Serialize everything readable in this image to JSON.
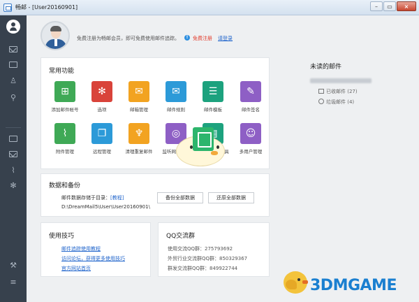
{
  "window": {
    "title": "畅邮 - [User20160901]",
    "min_label": "–",
    "max_label": "▭",
    "close_label": "×"
  },
  "sidebar": {
    "icons": [
      "avatar-icon",
      "mail-icon",
      "calendar-icon",
      "contacts-icon",
      "search-icon",
      "contact-card-icon",
      "compose-icon",
      "attachment-icon",
      "settings-icon",
      "tools-icon",
      "menu-icon"
    ]
  },
  "profile": {
    "free_text": "免费注册为畅邮会员，即可免费使用邮件追踪。",
    "register_label": "免费注册",
    "login_label": "请登录"
  },
  "common": {
    "title": "常用功能",
    "features": [
      {
        "label": "添加邮件帐号",
        "color": "#3fa956",
        "icon": "add-account-icon",
        "glyph": "⊞"
      },
      {
        "label": "选项",
        "color": "#d9433a",
        "icon": "gear-icon",
        "glyph": "✻"
      },
      {
        "label": "邮箱管理",
        "color": "#f2a321",
        "icon": "mailbox-manage-icon",
        "glyph": "✉"
      },
      {
        "label": "邮件规则",
        "color": "#2c9ad8",
        "icon": "mail-rule-icon",
        "glyph": "✉"
      },
      {
        "label": "邮件模板",
        "color": "#1da27e",
        "icon": "template-icon",
        "glyph": "☰"
      },
      {
        "label": "邮件签名",
        "color": "#8e5fc5",
        "icon": "signature-icon",
        "glyph": "✎"
      },
      {
        "label": "附件管理",
        "color": "#3fa956",
        "icon": "paperclip-icon",
        "glyph": "⌇"
      },
      {
        "label": "远程管理",
        "color": "#2c9ad8",
        "icon": "remote-icon",
        "glyph": "❐"
      },
      {
        "label": "清理重复邮件",
        "color": "#f2a321",
        "icon": "broom-icon",
        "glyph": "♆"
      },
      {
        "label": "监听网络数据",
        "color": "#8e5fc5",
        "icon": "radar-icon",
        "glyph": "◎"
      },
      {
        "label": "数据库修复工具",
        "color": "#1da27e",
        "icon": "database-repair-icon",
        "glyph": "▤"
      },
      {
        "label": "多用户管理",
        "color": "#8e5fc5",
        "icon": "users-icon",
        "glyph": "☺"
      }
    ]
  },
  "backup": {
    "title": "数据和备份",
    "path_label": "邮件数据存储于目录：",
    "tutorial_label": "[教程]",
    "path": "D:\\DreamMail5\\User\\User20160901\\",
    "backup_button": "备份全部数据",
    "restore_button": "还原全部数据"
  },
  "tips": {
    "title": "使用技巧",
    "links": [
      "邮件追踪使用教程",
      "访问论坛，获得更多使用技巧",
      "官方网站首页"
    ]
  },
  "qq": {
    "title": "QQ交流群",
    "lines": [
      "使用交流QQ群：275793692",
      "外贸行业交流群QQ群：850329367",
      "群发交流群QQ群：849922744"
    ]
  },
  "unread": {
    "title": "未读的邮件",
    "received_label": "已收邮件 (27)",
    "spam_label": "垃圾邮件 (4)"
  },
  "watermark": "3DMGAME"
}
